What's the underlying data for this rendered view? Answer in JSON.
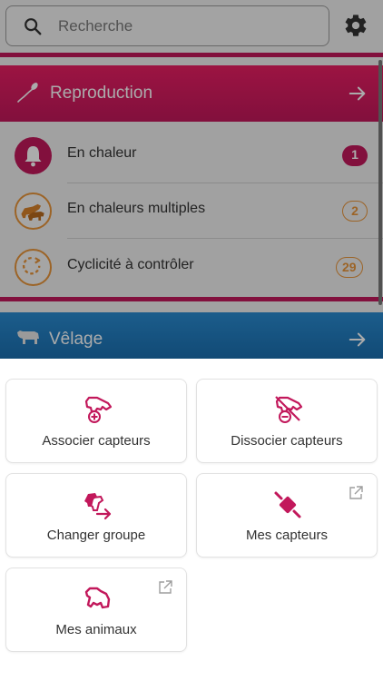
{
  "search": {
    "placeholder": "Recherche"
  },
  "colors": {
    "reproduction": "#c2185b",
    "velage": "#1f7bc0",
    "accent_orange": "#e9953b",
    "icon_magenta": "#c2185b"
  },
  "reproduction": {
    "title": "Reproduction",
    "items": [
      {
        "label": "En chaleur",
        "count": "1",
        "icon": "bell-icon"
      },
      {
        "label": "En chaleurs multiples",
        "count": "2",
        "icon": "mounting-cows-icon"
      },
      {
        "label": "Cyclicité à contrôler",
        "count": "29",
        "icon": "cycle-icon"
      }
    ]
  },
  "velage": {
    "title": "Vêlage"
  },
  "actions": [
    {
      "label": "Associer capteurs",
      "icon": "associate-sensor-icon",
      "external": false
    },
    {
      "label": "Dissocier capteurs",
      "icon": "dissociate-sensor-icon",
      "external": false
    },
    {
      "label": "Changer groupe",
      "icon": "change-group-icon",
      "external": false
    },
    {
      "label": "Mes capteurs",
      "icon": "sensor-collar-icon",
      "external": true
    },
    {
      "label": "Mes animaux",
      "icon": "animal-icon",
      "external": true
    }
  ]
}
